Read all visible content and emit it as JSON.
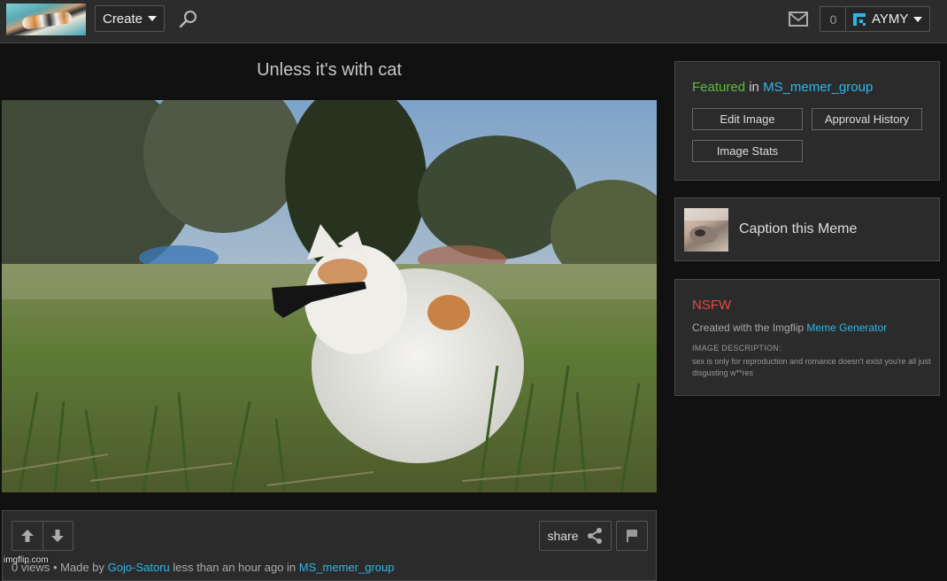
{
  "header": {
    "create_label": "Create",
    "notification_count": "0",
    "username": "AYMY"
  },
  "meme": {
    "title": "Unless it's with cat",
    "watermark": "imgflip.com"
  },
  "footer": {
    "share_label": "share",
    "views": "0 views",
    "separator": "•",
    "made_by_prefix": "Made by",
    "author": "Gojo-Satoru",
    "time_text": "less than an hour ago in",
    "stream": "MS_memer_group"
  },
  "sidebar": {
    "featured_word": "Featured",
    "featured_in": "in",
    "featured_stream": "MS_memer_group",
    "edit_image_label": "Edit Image",
    "approval_history_label": "Approval History",
    "image_stats_label": "Image Stats",
    "caption_label": "Caption this Meme",
    "nsfw_label": "NSFW",
    "created_prefix": "Created with the Imgflip",
    "meme_generator_link": "Meme Generator",
    "description_label": "IMAGE DESCRIPTION:",
    "description_text": "sex is only for reproduction and romance doesn't exist you're all just disgusting w**res"
  },
  "colors": {
    "accent_link": "#2eb7e6",
    "featured_green": "#5cbf3b",
    "nsfw_red": "#e84848",
    "user_icon_blue": "#2eb7e6"
  },
  "icons": [
    "search-icon",
    "mail-icon",
    "user-icon",
    "caret-down-icon",
    "upvote-icon",
    "downvote-icon",
    "share-icon",
    "flag-icon"
  ]
}
